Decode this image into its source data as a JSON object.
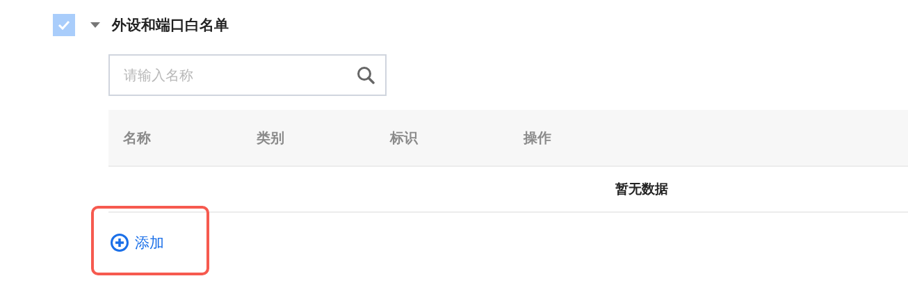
{
  "section": {
    "title": "外设和端口白名单",
    "checked": true,
    "expanded": true
  },
  "search": {
    "placeholder": "请输入名称"
  },
  "table": {
    "columns": [
      "名称",
      "类别",
      "标识",
      "操作"
    ],
    "empty_text": "暂无数据"
  },
  "add_button": {
    "label": "添加",
    "highlighted": true
  }
}
